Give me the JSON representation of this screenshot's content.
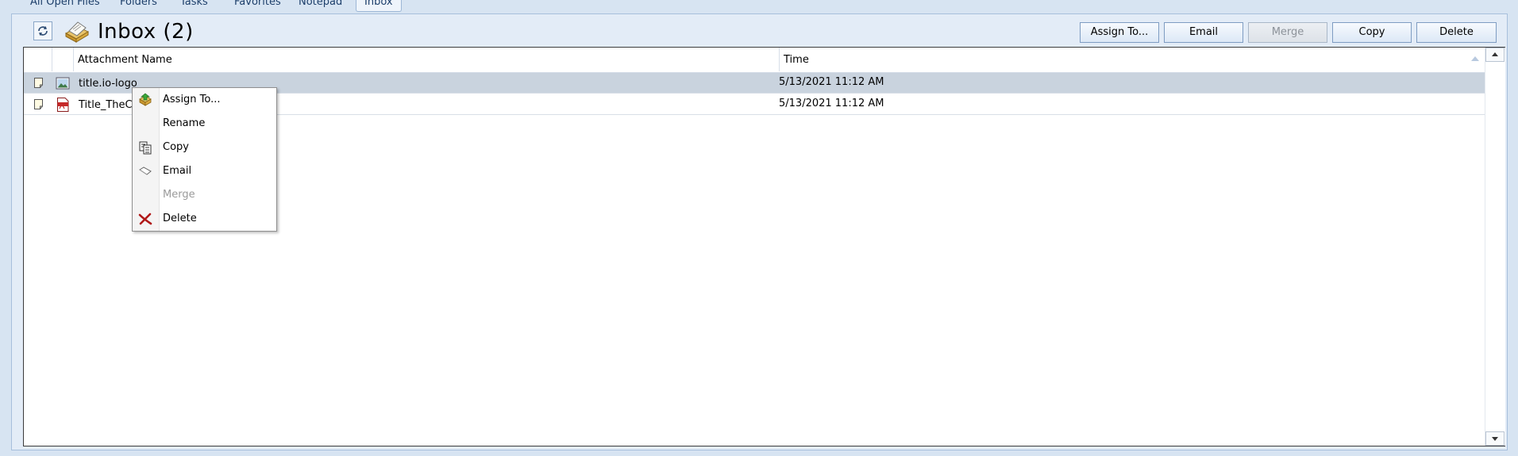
{
  "tabs": [
    {
      "label": "All Open Files",
      "active": false
    },
    {
      "label": "Folders",
      "active": false
    },
    {
      "label": "Tasks",
      "active": false
    },
    {
      "label": "Favorites",
      "active": false
    },
    {
      "label": "Notepad",
      "active": false
    },
    {
      "label": "Inbox",
      "active": true
    }
  ],
  "header": {
    "title": "Inbox  (2)"
  },
  "toolbar": {
    "assign_label": "Assign To...",
    "email_label": "Email",
    "merge_label": "Merge",
    "copy_label": "Copy",
    "delete_label": "Delete"
  },
  "grid": {
    "columns": [
      "Attachment Name",
      "Time"
    ],
    "rows": [
      {
        "name": "title.io-logo",
        "time": "5/13/2021 11:12 AM",
        "type": "image",
        "selected": true
      },
      {
        "name": "Title_TheCl",
        "time": "5/13/2021 11:12 AM",
        "type": "pdf",
        "selected": false
      }
    ]
  },
  "context_menu": {
    "items": [
      {
        "label": "Assign To...",
        "icon": "assign-icon",
        "enabled": true
      },
      {
        "label": "Rename",
        "icon": "",
        "enabled": true
      },
      {
        "label": "Copy",
        "icon": "copy-icon",
        "enabled": true
      },
      {
        "label": "Email",
        "icon": "email-icon",
        "enabled": true
      },
      {
        "label": "Merge",
        "icon": "",
        "enabled": false
      },
      {
        "label": "Delete",
        "icon": "delete-icon",
        "enabled": true
      }
    ]
  },
  "colors": {
    "background": "#d7e4f2",
    "selected_row": "#c9d3de",
    "accent": "#1d3f6b"
  }
}
